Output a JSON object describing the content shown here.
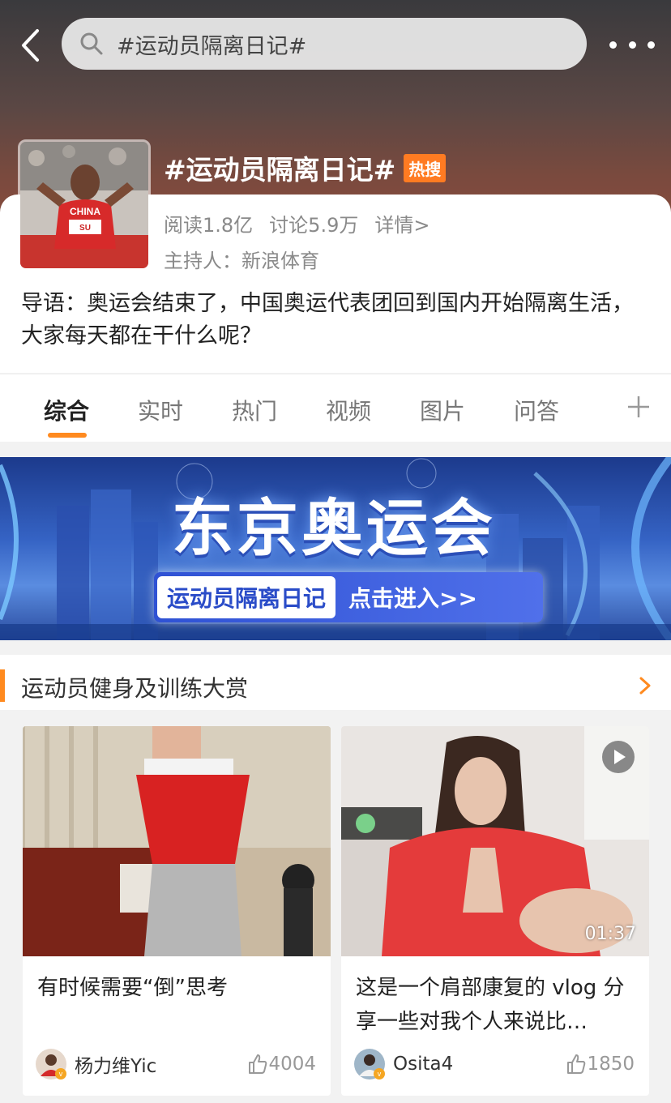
{
  "search": {
    "query": "#运动员隔离日记#"
  },
  "topic": {
    "title": "#运动员隔离日记#",
    "badge": "热搜",
    "reads": "阅读1.8亿",
    "discussions": "讨论5.9万",
    "detail_link": "详情>",
    "host": "主持人：新浪体育",
    "intro": "导语：奥运会结束了，中国奥运代表团回到国内开始隔离生活，大家每天都在干什么呢？",
    "avatar_shirt": "CHINA",
    "avatar_bib": "SU"
  },
  "tabs": [
    {
      "label": "综合"
    },
    {
      "label": "实时"
    },
    {
      "label": "热门"
    },
    {
      "label": "视频"
    },
    {
      "label": "图片"
    },
    {
      "label": "问答"
    }
  ],
  "banner": {
    "title": "东京奥运会",
    "pill_left": "运动员隔离日记",
    "pill_right": "点击进入>>"
  },
  "section": {
    "title": "运动员健身及训练大赏"
  },
  "cards": [
    {
      "text": "有时候需要“倒”思考",
      "author": "杨力维Yic",
      "likes": "4004"
    },
    {
      "text": "这是一个肩部康复的 vlog 分享一些对我个人来说比…",
      "author": "Osita4",
      "likes": "1850",
      "duration": "01:37"
    }
  ],
  "colors": {
    "accent": "#ff8a1f",
    "hot_badge": "#ff7b22",
    "verified": "#f5a623"
  },
  "icons": [
    "back-icon",
    "search-icon",
    "more-icon",
    "plus-icon",
    "chevron-right-icon",
    "thumbs-up-icon",
    "play-icon",
    "verified-badge-icon"
  ]
}
